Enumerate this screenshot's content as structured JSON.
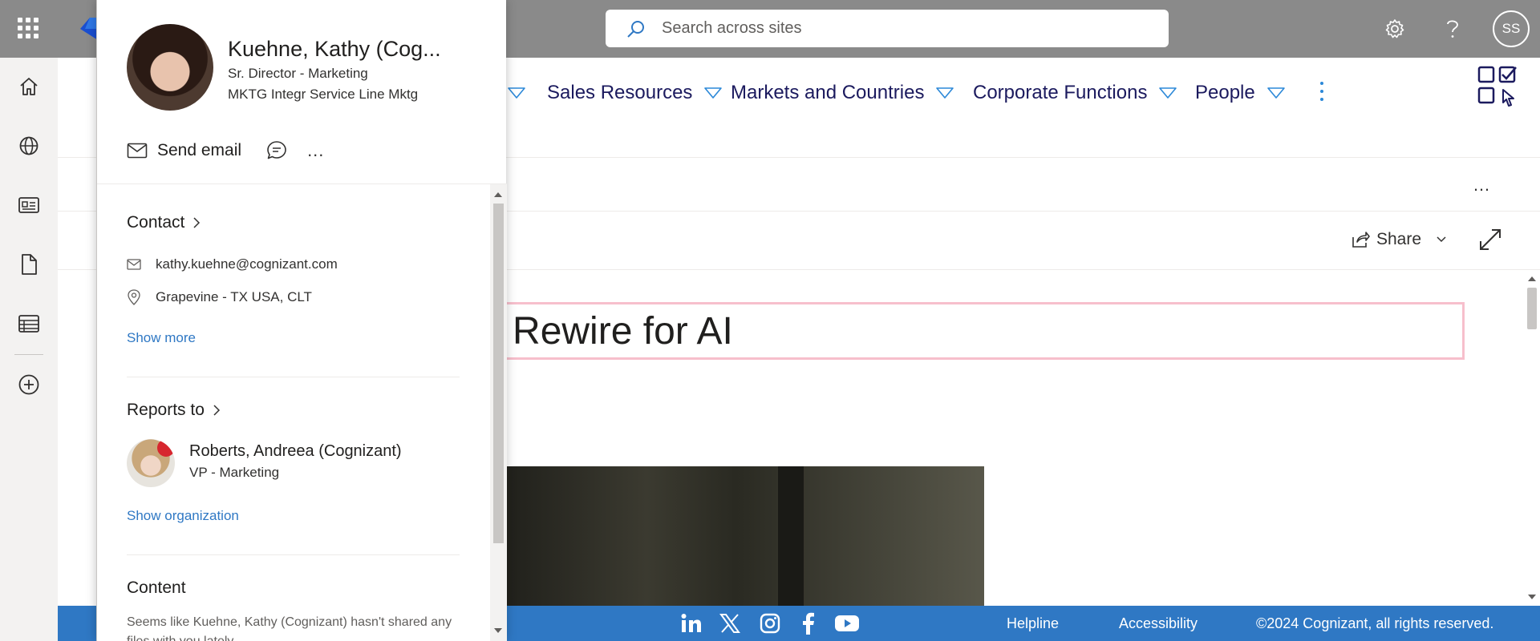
{
  "suite_bar": {
    "search_placeholder": "Search across sites",
    "settings_icon": "gear-icon",
    "help_icon": "question-icon",
    "user_initials": "SS",
    "background_color": "#8a8a8a"
  },
  "app_bar": {
    "items": [
      {
        "icon": "home-icon"
      },
      {
        "icon": "globe-icon"
      },
      {
        "icon": "news-icon"
      },
      {
        "icon": "document-icon"
      },
      {
        "icon": "list-icon"
      },
      {
        "icon": "add-circle-icon"
      }
    ]
  },
  "hub_nav": {
    "items": [
      {
        "label": "Sales Resources"
      },
      {
        "label": "Markets and Countries"
      },
      {
        "label": "Corporate Functions"
      },
      {
        "label": "People"
      }
    ],
    "link_color": "#1b1a5e",
    "chevron_color": "#2b88d8"
  },
  "command_bar": {
    "more_label": "…",
    "share_label": "Share"
  },
  "page": {
    "title": "n Rewire for AI"
  },
  "footer": {
    "social": [
      "linkedin-icon",
      "x-icon",
      "instagram-icon",
      "facebook-icon",
      "youtube-icon"
    ],
    "helpline": "Helpline",
    "accessibility": "Accessibility",
    "copyright": "©2024 Cognizant, all rights reserved.",
    "background_color": "#2f78c4"
  },
  "profile_card": {
    "name": "Kuehne, Kathy (Cog...",
    "job_title": "Sr. Director - Marketing",
    "department": "MKTG Integr Service Line Mktg",
    "send_email_label": "Send email",
    "more_label": "...",
    "contact": {
      "heading": "Contact",
      "email": "kathy.kuehne@cognizant.com",
      "location": "Grapevine - TX USA, CLT",
      "show_more": "Show more"
    },
    "reports_to": {
      "heading": "Reports to",
      "manager_name": "Roberts, Andreea (Cognizant)",
      "manager_title": "VP - Marketing",
      "show_org": "Show organization"
    },
    "content": {
      "heading": "Content",
      "text": "Seems like Kuehne, Kathy (Cognizant) hasn't shared any files with you lately."
    }
  }
}
